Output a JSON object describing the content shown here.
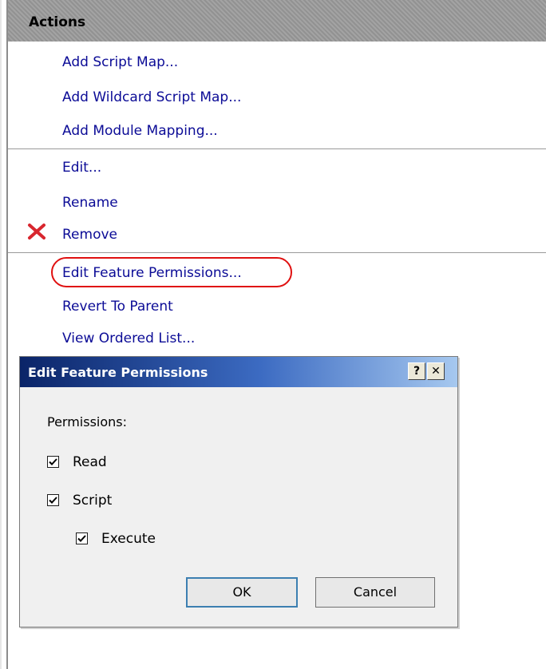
{
  "actions": {
    "title": "Actions",
    "group1": [
      "Add Script Map...",
      "Add Wildcard Script Map...",
      "Add Module Mapping..."
    ],
    "group2": [
      "Edit...",
      "Rename",
      "Remove"
    ],
    "group3": [
      "Edit Feature Permissions...",
      "Revert To Parent",
      "View Ordered List..."
    ]
  },
  "dialog": {
    "title": "Edit Feature Permissions",
    "help_glyph": "?",
    "close_glyph": "✕",
    "permissions_label": "Permissions:",
    "checkboxes": [
      {
        "label": "Read",
        "checked": true
      },
      {
        "label": "Script",
        "checked": true
      },
      {
        "label": "Execute",
        "checked": true
      }
    ],
    "ok_label": "OK",
    "cancel_label": "Cancel"
  },
  "icons": {
    "remove": "x-icon"
  },
  "colors": {
    "link": "#0b0b96",
    "header_bg": "#9b9b9b",
    "highlight": "#e01010",
    "remove_icon": "#d8262e"
  }
}
